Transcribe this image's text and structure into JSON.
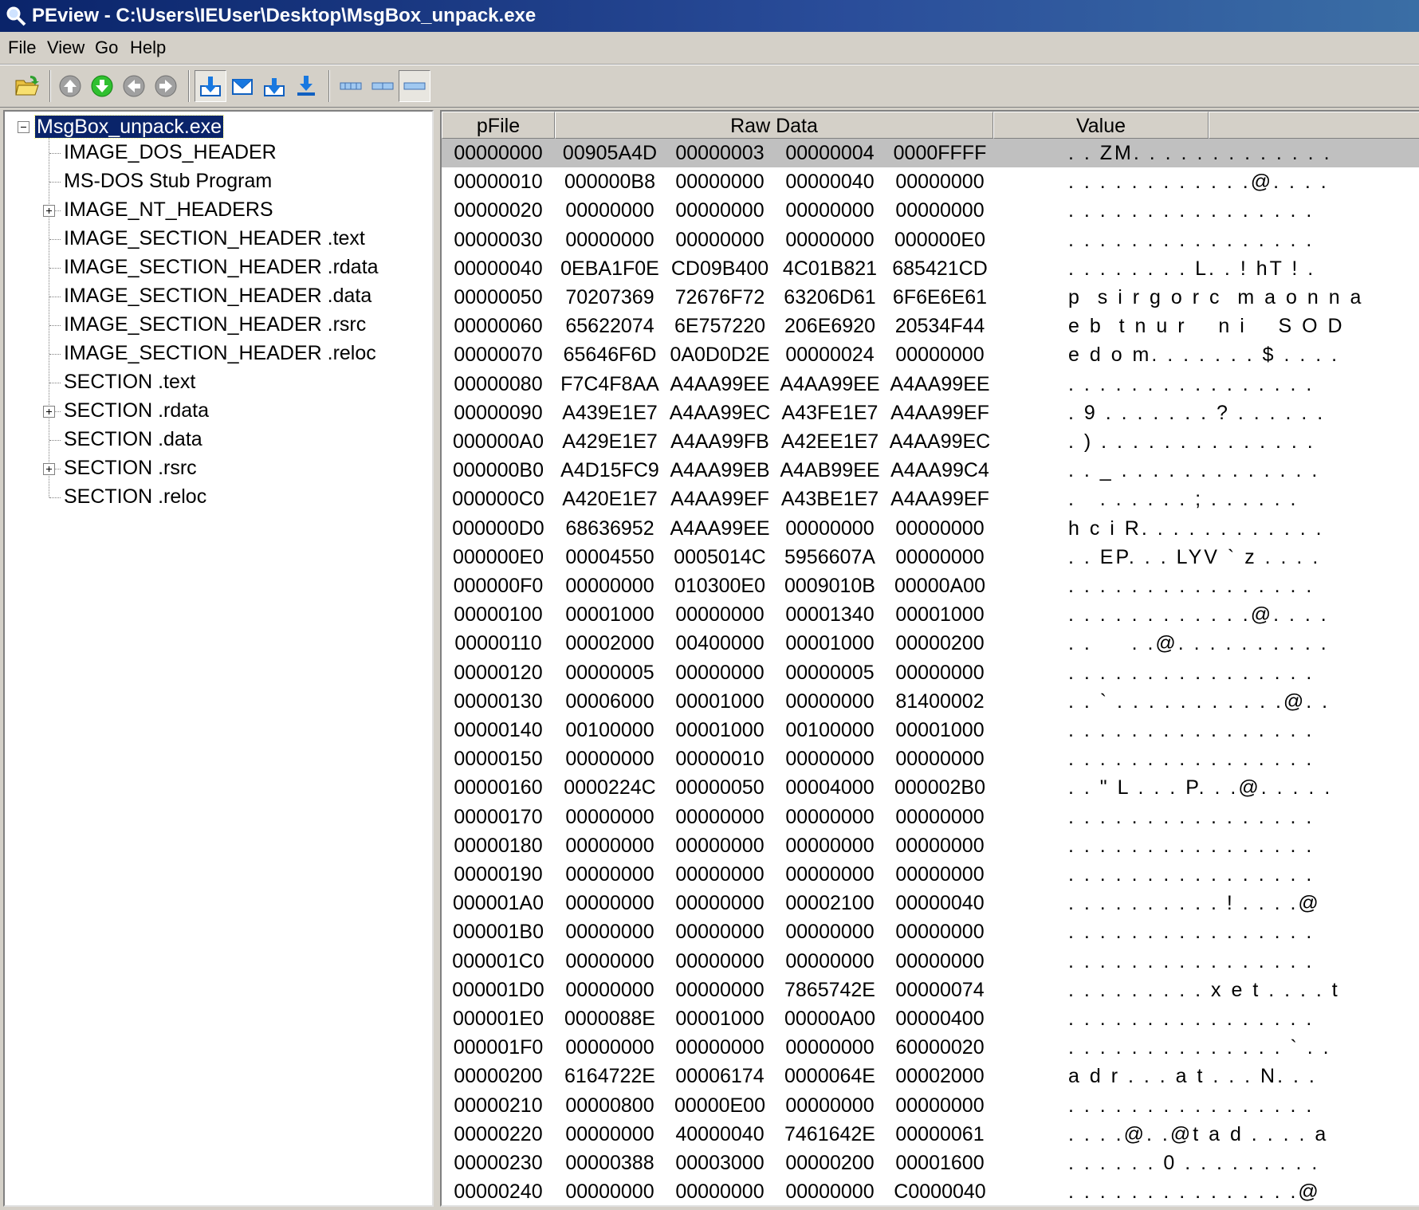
{
  "window": {
    "title": "PEview - C:\\Users\\IEUser\\Desktop\\MsgBox_unpack.exe",
    "icon": "magnifier-icon"
  },
  "menu": [
    "File",
    "View",
    "Go",
    "Help"
  ],
  "toolbar": {
    "buttons": [
      {
        "name": "open-file-button",
        "icon": "folder-open-icon"
      },
      {
        "name": "nav-up-button",
        "icon": "arrow-up-circle-icon"
      },
      {
        "name": "nav-down-button",
        "icon": "arrow-down-circle-icon"
      },
      {
        "name": "nav-back-button",
        "icon": "arrow-left-circle-icon"
      },
      {
        "name": "nav-forward-button",
        "icon": "arrow-right-circle-icon"
      },
      {
        "name": "view-hex-button",
        "icon": "download-arrow-icon",
        "pressed": true
      },
      {
        "name": "view-envelope-button",
        "icon": "envelope-icon"
      },
      {
        "name": "view-next-button",
        "icon": "arrow-down-box-icon"
      },
      {
        "name": "view-last-button",
        "icon": "arrow-down-bar-icon"
      },
      {
        "name": "size-byte-button",
        "icon": "byte-width-icon"
      },
      {
        "name": "size-word-button",
        "icon": "word-width-icon"
      },
      {
        "name": "size-dword-button",
        "icon": "dword-width-icon",
        "pressed": true
      }
    ]
  },
  "tree": {
    "root": "MsgBox_unpack.exe",
    "items": [
      {
        "label": "IMAGE_DOS_HEADER",
        "expandable": false
      },
      {
        "label": "MS-DOS Stub Program",
        "expandable": false
      },
      {
        "label": "IMAGE_NT_HEADERS",
        "expandable": true
      },
      {
        "label": "IMAGE_SECTION_HEADER .text",
        "expandable": false
      },
      {
        "label": "IMAGE_SECTION_HEADER .rdata",
        "expandable": false
      },
      {
        "label": "IMAGE_SECTION_HEADER .data",
        "expandable": false
      },
      {
        "label": "IMAGE_SECTION_HEADER .rsrc",
        "expandable": false
      },
      {
        "label": "IMAGE_SECTION_HEADER .reloc",
        "expandable": false
      },
      {
        "label": "SECTION .text",
        "expandable": false
      },
      {
        "label": "SECTION .rdata",
        "expandable": true
      },
      {
        "label": "SECTION .data",
        "expandable": false
      },
      {
        "label": "SECTION .rsrc",
        "expandable": true
      },
      {
        "label": "SECTION .reloc",
        "expandable": false
      }
    ]
  },
  "columns": {
    "pfile": "pFile",
    "raw": "Raw Data",
    "value": "Value"
  },
  "rows": [
    {
      "off": "00000000",
      "d": [
        "00905A4D",
        "00000003",
        "00000004",
        "0000FFFF"
      ],
      "v": ". . ZM. . . . . . . . . . . . ."
    },
    {
      "off": "00000010",
      "d": [
        "000000B8",
        "00000000",
        "00000040",
        "00000000"
      ],
      "v": ". . . . . . . . . . . .@. . . ."
    },
    {
      "off": "00000020",
      "d": [
        "00000000",
        "00000000",
        "00000000",
        "00000000"
      ],
      "v": ". . . . . . . . . . . . . . . ."
    },
    {
      "off": "00000030",
      "d": [
        "00000000",
        "00000000",
        "00000000",
        "000000E0"
      ],
      "v": ". . . . . . . . . . . . . . . ."
    },
    {
      "off": "00000040",
      "d": [
        "0EBA1F0E",
        "CD09B400",
        "4C01B821",
        "685421CD"
      ],
      "v": ". . . . . . . . L. . ! hT ! ."
    },
    {
      "off": "00000050",
      "d": [
        "70207369",
        "72676F72",
        "63206D61",
        "6F6E6E61"
      ],
      "v": "p  s i r g o r c  m a o n n a"
    },
    {
      "off": "00000060",
      "d": [
        "65622074",
        "6E757220",
        "206E6920",
        "20534F44"
      ],
      "v": "e b  t n u r    n i    S O D"
    },
    {
      "off": "00000070",
      "d": [
        "65646F6D",
        "0A0D0D2E",
        "00000024",
        "00000000"
      ],
      "v": "e d o m. . . . . . . $ . . . ."
    },
    {
      "off": "00000080",
      "d": [
        "F7C4F8AA",
        "A4AA99EE",
        "A4AA99EE",
        "A4AA99EE"
      ],
      "v": ". . . . . . . . . . . . . . . ."
    },
    {
      "off": "00000090",
      "d": [
        "A439E1E7",
        "A4AA99EC",
        "A43FE1E7",
        "A4AA99EF"
      ],
      "v": ". 9 . . . . . . . ? . . . . . ."
    },
    {
      "off": "000000A0",
      "d": [
        "A429E1E7",
        "A4AA99FB",
        "A42EE1E7",
        "A4AA99EC"
      ],
      "v": ". ) . . . . . . . . . . . . . ."
    },
    {
      "off": "000000B0",
      "d": [
        "A4D15FC9",
        "A4AA99EB",
        "A4AB99EE",
        "A4AA99C4"
      ],
      "v": ". . _ . . . . . . . . . . . . ."
    },
    {
      "off": "000000C0",
      "d": [
        "A420E1E7",
        "A4AA99EF",
        "A43BE1E7",
        "A4AA99EF"
      ],
      "v": ".   . . . . . . ; . . . . . ."
    },
    {
      "off": "000000D0",
      "d": [
        "68636952",
        "A4AA99EE",
        "00000000",
        "00000000"
      ],
      "v": "h c i R. . . . . . . . . . . ."
    },
    {
      "off": "000000E0",
      "d": [
        "00004550",
        "0005014C",
        "5956607A",
        "00000000"
      ],
      "v": ". . EP. . . LYV ` z . . . ."
    },
    {
      "off": "000000F0",
      "d": [
        "00000000",
        "010300E0",
        "0009010B",
        "00000A00"
      ],
      "v": ". . . . . . . . . . . . . . . ."
    },
    {
      "off": "00000100",
      "d": [
        "00001000",
        "00000000",
        "00001340",
        "00001000"
      ],
      "v": ". . . . . . . . . . . .@. . . ."
    },
    {
      "off": "00000110",
      "d": [
        "00002000",
        "00400000",
        "00001000",
        "00000200"
      ],
      "v": ". .     . .@. . . . . . . . . ."
    },
    {
      "off": "00000120",
      "d": [
        "00000005",
        "00000000",
        "00000005",
        "00000000"
      ],
      "v": ". . . . . . . . . . . . . . . ."
    },
    {
      "off": "00000130",
      "d": [
        "00006000",
        "00001000",
        "00000000",
        "81400002"
      ],
      "v": ". . ` . . . . . . . . . . .@. ."
    },
    {
      "off": "00000140",
      "d": [
        "00100000",
        "00001000",
        "00100000",
        "00001000"
      ],
      "v": ". . . . . . . . . . . . . . . ."
    },
    {
      "off": "00000150",
      "d": [
        "00000000",
        "00000010",
        "00000000",
        "00000000"
      ],
      "v": ". . . . . . . . . . . . . . . ."
    },
    {
      "off": "00000160",
      "d": [
        "0000224C",
        "00000050",
        "00004000",
        "000002B0"
      ],
      "v": ". . \" L . . . P. . .@. . . . ."
    },
    {
      "off": "00000170",
      "d": [
        "00000000",
        "00000000",
        "00000000",
        "00000000"
      ],
      "v": ". . . . . . . . . . . . . . . ."
    },
    {
      "off": "00000180",
      "d": [
        "00000000",
        "00000000",
        "00000000",
        "00000000"
      ],
      "v": ". . . . . . . . . . . . . . . ."
    },
    {
      "off": "00000190",
      "d": [
        "00000000",
        "00000000",
        "00000000",
        "00000000"
      ],
      "v": ". . . . . . . . . . . . . . . ."
    },
    {
      "off": "000001A0",
      "d": [
        "00000000",
        "00000000",
        "00002100",
        "00000040"
      ],
      "v": ". . . . . . . . . . ! . . . .@"
    },
    {
      "off": "000001B0",
      "d": [
        "00000000",
        "00000000",
        "00000000",
        "00000000"
      ],
      "v": ". . . . . . . . . . . . . . . ."
    },
    {
      "off": "000001C0",
      "d": [
        "00000000",
        "00000000",
        "00000000",
        "00000000"
      ],
      "v": ". . . . . . . . . . . . . . . ."
    },
    {
      "off": "000001D0",
      "d": [
        "00000000",
        "00000000",
        "7865742E",
        "00000074"
      ],
      "v": ". . . . . . . . . x e t . . . . t"
    },
    {
      "off": "000001E0",
      "d": [
        "0000088E",
        "00001000",
        "00000A00",
        "00000400"
      ],
      "v": ". . . . . . . . . . . . . . . ."
    },
    {
      "off": "000001F0",
      "d": [
        "00000000",
        "00000000",
        "00000000",
        "60000020"
      ],
      "v": ". . . . . . . . . . . . . . ` . ."
    },
    {
      "off": "00000200",
      "d": [
        "6164722E",
        "00006174",
        "0000064E",
        "00002000"
      ],
      "v": "a d r . . . a t . . . N. . ."
    },
    {
      "off": "00000210",
      "d": [
        "00000800",
        "00000E00",
        "00000000",
        "00000000"
      ],
      "v": ". . . . . . . . . . . . . . . ."
    },
    {
      "off": "00000220",
      "d": [
        "00000000",
        "40000040",
        "7461642E",
        "00000061"
      ],
      "v": ". . . .@. .@t a d . . . . a"
    },
    {
      "off": "00000230",
      "d": [
        "00000388",
        "00003000",
        "00000200",
        "00001600"
      ],
      "v": ". . . . . . 0 . . . . . . . . ."
    },
    {
      "off": "00000240",
      "d": [
        "00000000",
        "00000000",
        "00000000",
        "C0000040"
      ],
      "v": ". . . . . . . . . . . . . . .@"
    }
  ]
}
